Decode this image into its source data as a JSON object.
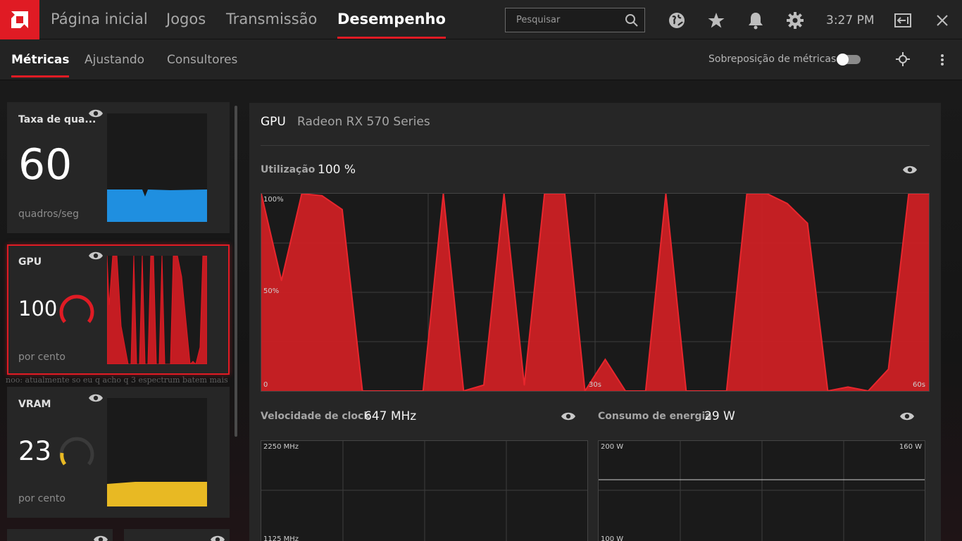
{
  "header": {
    "logo": "amd-logo",
    "nav": [
      "Página inicial",
      "Jogos",
      "Transmissão",
      "Desempenho"
    ],
    "active_nav": "Desempenho",
    "search_placeholder": "Pesquisar",
    "time": "3:27 PM",
    "icons": [
      "globe-icon",
      "star-icon",
      "bell-icon",
      "gear-icon",
      "exit-icon",
      "close-icon"
    ]
  },
  "subnav": {
    "tabs": [
      "Métricas",
      "Ajustando",
      "Consultores"
    ],
    "active_tab": "Métricas",
    "overlay_label": "Sobreposição de métricas",
    "overlay_on": false
  },
  "background_text": "noo: atualmente so eu q acho q 3 espectrum batem mais",
  "cards": {
    "fps": {
      "title": "Taxa de qua...",
      "value": "60",
      "unit": "quadros/seg",
      "color": "#1f8fe0"
    },
    "gpu": {
      "title": "GPU",
      "value": "100",
      "unit": "por cento",
      "gauge": 1.0,
      "color": "#e01b24"
    },
    "vram": {
      "title": "VRAM",
      "value": "23",
      "unit": "por cento",
      "gauge": 0.23,
      "color": "#e8b923"
    }
  },
  "panel": {
    "label": "GPU",
    "device": "Radeon RX 570 Series",
    "utilization": {
      "label": "Utilização",
      "value": "100 %",
      "y_top": "100%",
      "y_mid": "50%",
      "y_bottom": "0",
      "x_mid": "30s",
      "x_end": "60s"
    },
    "clock": {
      "label": "Velocidade de clock",
      "value": "647 MHz",
      "y_top": "2250 MHz",
      "y_mid": "1125 MHz"
    },
    "power": {
      "label": "Consumo de energia",
      "value": "29 W",
      "y_top": "200 W",
      "y_mid": "100 W",
      "limit_label": "160 W"
    }
  },
  "chart_data": {
    "type": "area",
    "title": "Utilização",
    "xlabel": "",
    "ylabel": "",
    "xlim": [
      0,
      60
    ],
    "ylim": [
      0,
      100
    ],
    "x_ticks": [
      "30s",
      "60s"
    ],
    "y_ticks": [
      "100%",
      "50%",
      "0"
    ],
    "x": [
      0,
      2,
      4,
      6,
      8,
      10,
      12,
      14,
      16,
      18,
      20,
      22,
      24,
      26,
      28,
      30,
      32,
      34,
      36,
      38,
      40,
      42,
      44,
      46,
      48,
      50,
      52,
      54,
      56,
      58,
      60
    ],
    "values": [
      100,
      56,
      100,
      99,
      92,
      0,
      0,
      0,
      0,
      100,
      0,
      3,
      100,
      3,
      100,
      100,
      0,
      16,
      0,
      0,
      100,
      0,
      0,
      0,
      100,
      100,
      95,
      85,
      0,
      2,
      0,
      11,
      100,
      100
    ],
    "series_color": "#d11f24"
  }
}
